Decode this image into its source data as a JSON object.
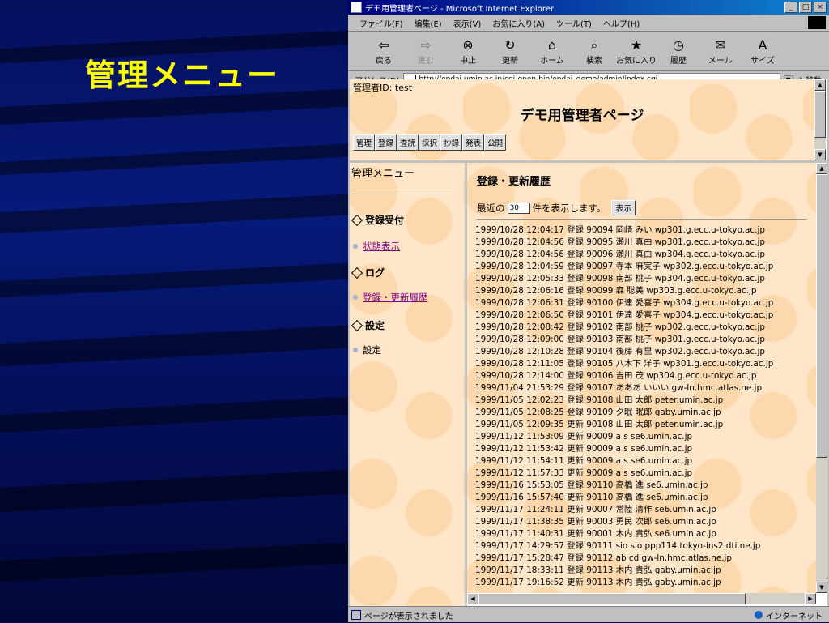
{
  "slide": {
    "title": "管理メニュー"
  },
  "window": {
    "title": "デモ用管理者ページ - Microsoft Internet Explorer",
    "controls": [
      "_",
      "□",
      "×"
    ]
  },
  "menubar": [
    "ファイル(F)",
    "編集(E)",
    "表示(V)",
    "お気に入り(A)",
    "ツール(T)",
    "ヘルプ(H)"
  ],
  "toolbar": [
    {
      "label": "戻る",
      "icon": "⇦"
    },
    {
      "label": "進む",
      "icon": "⇨"
    },
    {
      "label": "中止",
      "icon": "⊗"
    },
    {
      "label": "更新",
      "icon": "↻"
    },
    {
      "label": "ホーム",
      "icon": "⌂"
    },
    {
      "label": "検索",
      "icon": "⌕"
    },
    {
      "label": "お気に入り",
      "icon": "★"
    },
    {
      "label": "履歴",
      "icon": "◷"
    },
    {
      "label": "メール",
      "icon": "✉"
    },
    {
      "label": "サイズ",
      "icon": "A"
    }
  ],
  "address": {
    "label": "アドレス(D)",
    "url": "http://endai.umin.ac.jp/cgi-open-bin/endai_demo/admin/index.cgi",
    "go_label": "移動"
  },
  "header_frame": {
    "admin_id": "管理者ID: test",
    "page_title": "デモ用管理者ページ",
    "nav_buttons": [
      "管理",
      "登録",
      "査読",
      "採択",
      "抄録",
      "発表",
      "公開"
    ]
  },
  "left_menu": {
    "title": "管理メニュー",
    "sections": [
      {
        "heading": "登録受付",
        "item": "状態表示",
        "link": true
      },
      {
        "heading": "ログ",
        "item": "登録・更新履歴",
        "link": true
      },
      {
        "heading": "設定",
        "item": "設定",
        "link": false
      }
    ]
  },
  "log_panel": {
    "title": "登録・更新履歴",
    "recent_prefix": "最近の",
    "recent_count": "30",
    "recent_suffix": "件を表示します。",
    "show_button": "表示",
    "entries": [
      "1999/10/28 12:04:17 登録 90094 岡崎 みい wp301.g.ecc.u-tokyo.ac.jp",
      "1999/10/28 12:04:56 登録 90095 瀬川 真由 wp301.g.ecc.u-tokyo.ac.jp",
      "1999/10/28 12:04:56 登録 90096 瀬川 真由 wp304.g.ecc.u-tokyo.ac.jp",
      "1999/10/28 12:04:59 登録 90097 寺本 麻実子 wp302.g.ecc.u-tokyo.ac.jp",
      "1999/10/28 12:05:33 登録 90098 南部 桃子 wp304.g.ecc.u-tokyo.ac.jp",
      "1999/10/28 12:06:16 登録 90099 森 聡美 wp303.g.ecc.u-tokyo.ac.jp",
      "1999/10/28 12:06:31 登録 90100 伊達 愛喜子 wp304.g.ecc.u-tokyo.ac.jp",
      "1999/10/28 12:06:50 登録 90101 伊達 愛喜子 wp304.g.ecc.u-tokyo.ac.jp",
      "1999/10/28 12:08:42 登録 90102 南部 桃子 wp302.g.ecc.u-tokyo.ac.jp",
      "1999/10/28 12:09:00 登録 90103 南部 桃子 wp301.g.ecc.u-tokyo.ac.jp",
      "1999/10/28 12:10:28 登録 90104 後藤 有里 wp302.g.ecc.u-tokyo.ac.jp",
      "1999/10/28 12:11:05 登録 90105 八木下 洋子 wp301.g.ecc.u-tokyo.ac.jp",
      "1999/10/28 12:14:00 登録 90106 吉田 茂 wp304.g.ecc.u-tokyo.ac.jp",
      "1999/11/04 21:53:29 登録 90107 あああ いいい gw-ln.hmc.atlas.ne.jp",
      "1999/11/05 12:02:23 登録 90108 山田 太郎 peter.umin.ac.jp",
      "1999/11/05 12:08:25 登録 90109 夕眠 眠郎 gaby.umin.ac.jp",
      "1999/11/05 12:09:35 更新 90108 山田 太郎 peter.umin.ac.jp",
      "1999/11/12 11:53:09 更新 90009 a s se6.umin.ac.jp",
      "1999/11/12 11:53:42 更新 90009 a s se6.umin.ac.jp",
      "1999/11/12 11:54:11 更新 90009 a s se6.umin.ac.jp",
      "1999/11/12 11:57:33 更新 90009 a s se6.umin.ac.jp",
      "1999/11/16 15:53:05 登録 90110 高橋 進 se6.umin.ac.jp",
      "1999/11/16 15:57:40 更新 90110 高橋 進 se6.umin.ac.jp",
      "1999/11/17 11:24:11 更新 90007 常陸 清作 se6.umin.ac.jp",
      "1999/11/17 11:38:35 更新 90003 勇民 次郎 se6.umin.ac.jp",
      "1999/11/17 11:40:31 更新 90001 木内 貴弘 se6.umin.ac.jp",
      "1999/11/17 14:29:57 登録 90111 sio sio ppp114.tokyo-ins2.dti.ne.jp",
      "1999/11/17 15:28:47 登録 90112 ab cd gw-ln.hmc.atlas.ne.jp",
      "1999/11/17 18:33:11 登録 90113 木内 貴弘 gaby.umin.ac.jp",
      "1999/11/17 19:16:52 更新 90113 木内 貴弘 gaby.umin.ac.jp"
    ]
  },
  "status": {
    "text": "ページが表示されました",
    "zone": "インターネット"
  },
  "colors": {
    "slide_title": "#ffff00",
    "frame_bg": "#ffe6c8",
    "titlebar": "#000080"
  }
}
